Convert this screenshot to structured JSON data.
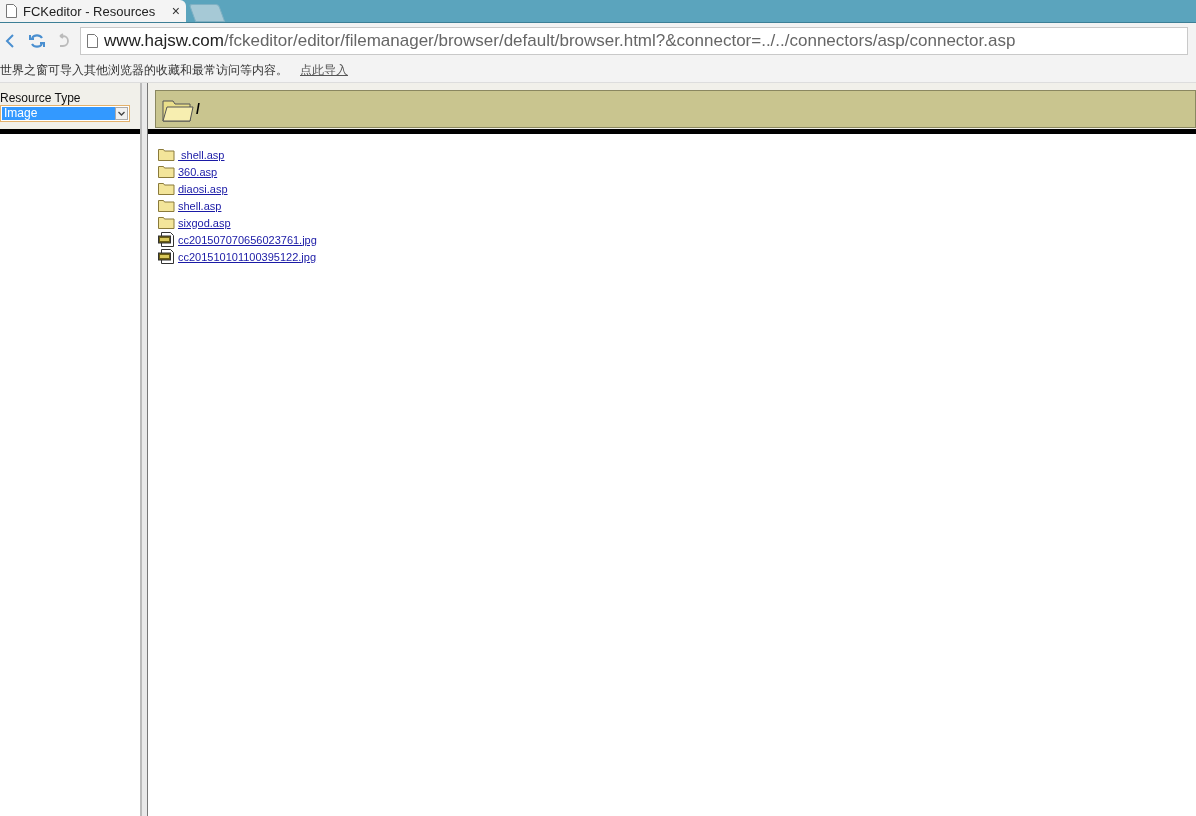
{
  "tab": {
    "title": "FCKeditor - Resources",
    "close": "×"
  },
  "address": {
    "host": "www.hajsw.com",
    "path": "/fckeditor/editor/filemanager/browser/default/browser.html?&connector=../../connectors/asp/connector.asp"
  },
  "import_bar": {
    "message": "世界之窗可导入其他浏览器的收藏和最常访问等内容。",
    "link": "点此导入"
  },
  "resource_type": {
    "label": "Resource Type",
    "value": "Image"
  },
  "current_folder": {
    "path": "/"
  },
  "files": [
    {
      "kind": "folder",
      "name": " shell.asp"
    },
    {
      "kind": "folder",
      "name": "360.asp"
    },
    {
      "kind": "folder",
      "name": "diaosi.asp"
    },
    {
      "kind": "folder",
      "name": "shell.asp"
    },
    {
      "kind": "folder",
      "name": "sixgod.asp"
    },
    {
      "kind": "image",
      "name": "cc201507070656023761.jpg"
    },
    {
      "kind": "image",
      "name": "cc201510101100395122.jpg"
    }
  ]
}
